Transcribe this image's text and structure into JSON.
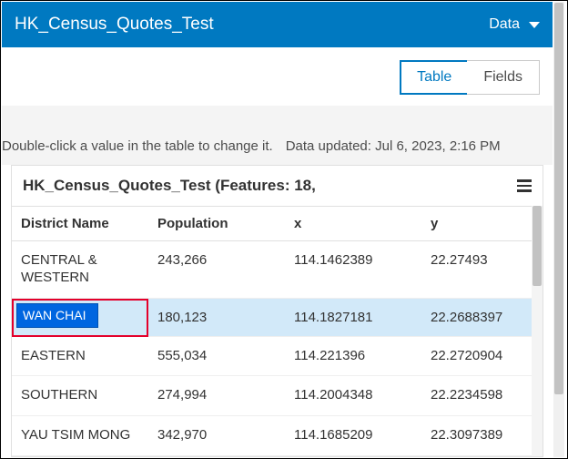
{
  "header": {
    "title": "HK_Census_Quotes_Test",
    "dropdown_label": "Data"
  },
  "tabs": {
    "table": "Table",
    "fields": "Fields",
    "active": "table"
  },
  "hint": {
    "edit": "Double-click a value in the table to change it.",
    "updated": "Data updated: Jul 6, 2023, 2:16 PM"
  },
  "table": {
    "title": "HK_Census_Quotes_Test (Features: 18,",
    "columns": {
      "district": "District Name",
      "population": "Population",
      "x": "x",
      "y": "y"
    },
    "rows": [
      {
        "district": "CENTRAL & WESTERN",
        "population": "243,266",
        "x": "114.1462389",
        "y": "22.27493"
      },
      {
        "district": "WAN CHAI",
        "population": "180,123",
        "x": "114.1827181",
        "y": "22.2688397"
      },
      {
        "district": "EASTERN",
        "population": "555,034",
        "x": "114.221396",
        "y": "22.2720904"
      },
      {
        "district": "SOUTHERN",
        "population": "274,994",
        "x": "114.2004348",
        "y": "22.2234598"
      },
      {
        "district": "YAU TSIM MONG",
        "population": "342,970",
        "x": "114.1685209",
        "y": "22.3097389"
      }
    ],
    "editing_row_index": 1,
    "editing_value": "WAN CHAI"
  }
}
